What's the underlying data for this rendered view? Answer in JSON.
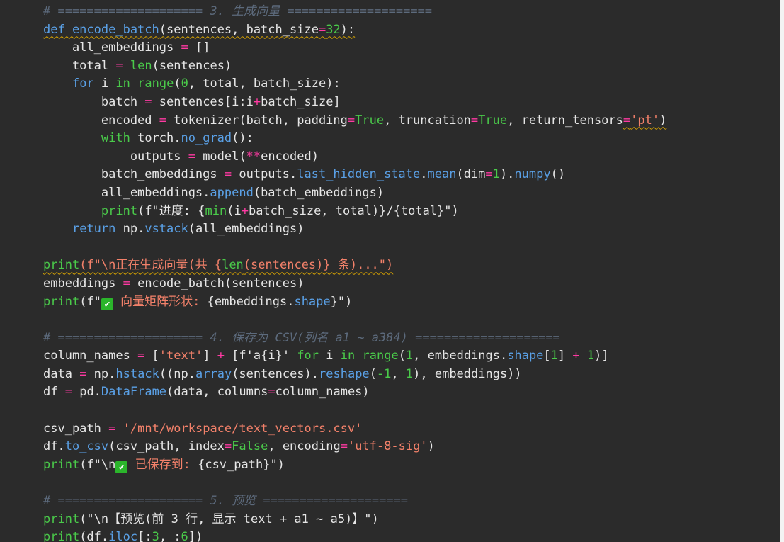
{
  "editor": {
    "colors": {
      "background": "#2b2b2b",
      "comment": "#5c6a7c",
      "keyword": "#4aca4a",
      "function": "#5aa0e6",
      "string": "#f3816a",
      "operator": "#ff3aa3",
      "text": "#e6e6e6",
      "warning_underline": "#d9a400"
    },
    "lines": [
      [
        {
          "t": "# ==================== 3. 生成向量 ====================",
          "c": "c"
        }
      ],
      [
        {
          "t": "def encode_batch",
          "c": "f",
          "u": true
        },
        {
          "t": "(sentences, batch_size",
          "c": "d",
          "u": true
        },
        {
          "t": "=",
          "c": "o",
          "u": true
        },
        {
          "t": "32",
          "c": "n",
          "u": true
        },
        {
          "t": "):",
          "c": "d",
          "u": true
        }
      ],
      [
        {
          "t": "    all_embeddings ",
          "c": "d"
        },
        {
          "t": "=",
          "c": "o"
        },
        {
          "t": " []",
          "c": "d"
        }
      ],
      [
        {
          "t": "    total ",
          "c": "d"
        },
        {
          "t": "=",
          "c": "o"
        },
        {
          "t": " ",
          "c": "d"
        },
        {
          "t": "len",
          "c": "k"
        },
        {
          "t": "(sentences)",
          "c": "d"
        }
      ],
      [
        {
          "t": "    ",
          "c": "d"
        },
        {
          "t": "for",
          "c": "f"
        },
        {
          "t": " i ",
          "c": "d"
        },
        {
          "t": "in",
          "c": "k"
        },
        {
          "t": " ",
          "c": "d"
        },
        {
          "t": "range",
          "c": "k"
        },
        {
          "t": "(",
          "c": "d"
        },
        {
          "t": "0",
          "c": "n"
        },
        {
          "t": ", total, batch_size):",
          "c": "d"
        }
      ],
      [
        {
          "t": "        batch ",
          "c": "d"
        },
        {
          "t": "=",
          "c": "o"
        },
        {
          "t": " sentences[i:i",
          "c": "d"
        },
        {
          "t": "+",
          "c": "o"
        },
        {
          "t": "batch_size]",
          "c": "d"
        }
      ],
      [
        {
          "t": "        encoded ",
          "c": "d"
        },
        {
          "t": "=",
          "c": "o"
        },
        {
          "t": " tokenizer(batch, padding",
          "c": "d"
        },
        {
          "t": "=",
          "c": "o"
        },
        {
          "t": "True",
          "c": "k"
        },
        {
          "t": ", truncation",
          "c": "d"
        },
        {
          "t": "=",
          "c": "o"
        },
        {
          "t": "True",
          "c": "k"
        },
        {
          "t": ", return_tensors",
          "c": "d"
        },
        {
          "t": "=",
          "c": "o",
          "u": true
        },
        {
          "t": "'pt'",
          "c": "s",
          "u": true
        },
        {
          "t": ")",
          "c": "d",
          "u": true
        }
      ],
      [
        {
          "t": "        ",
          "c": "d"
        },
        {
          "t": "with",
          "c": "k"
        },
        {
          "t": " torch.",
          "c": "d"
        },
        {
          "t": "no_grad",
          "c": "f"
        },
        {
          "t": "():",
          "c": "d"
        }
      ],
      [
        {
          "t": "            outputs ",
          "c": "d"
        },
        {
          "t": "=",
          "c": "o"
        },
        {
          "t": " model(",
          "c": "d"
        },
        {
          "t": "**",
          "c": "o"
        },
        {
          "t": "encoded)",
          "c": "d"
        }
      ],
      [
        {
          "t": "        batch_embeddings ",
          "c": "d"
        },
        {
          "t": "=",
          "c": "o"
        },
        {
          "t": " outputs.",
          "c": "d"
        },
        {
          "t": "last_hidden_state",
          "c": "f"
        },
        {
          "t": ".",
          "c": "d"
        },
        {
          "t": "mean",
          "c": "f"
        },
        {
          "t": "(dim",
          "c": "d"
        },
        {
          "t": "=",
          "c": "o"
        },
        {
          "t": "1",
          "c": "n"
        },
        {
          "t": ").",
          "c": "d"
        },
        {
          "t": "numpy",
          "c": "f"
        },
        {
          "t": "()",
          "c": "d"
        }
      ],
      [
        {
          "t": "        all_embeddings.",
          "c": "d"
        },
        {
          "t": "append",
          "c": "f"
        },
        {
          "t": "(batch_embeddings)",
          "c": "d"
        }
      ],
      [
        {
          "t": "        ",
          "c": "d"
        },
        {
          "t": "print",
          "c": "k"
        },
        {
          "t": "(f\"进度: {",
          "c": "d"
        },
        {
          "t": "min",
          "c": "k"
        },
        {
          "t": "(i",
          "c": "d"
        },
        {
          "t": "+",
          "c": "o"
        },
        {
          "t": "batch_size, total)}/{total}\")",
          "c": "d"
        }
      ],
      [
        {
          "t": "    ",
          "c": "d"
        },
        {
          "t": "return",
          "c": "f"
        },
        {
          "t": " np.",
          "c": "d"
        },
        {
          "t": "vstack",
          "c": "f"
        },
        {
          "t": "(all_embeddings)",
          "c": "d"
        }
      ],
      [],
      [
        {
          "t": "print",
          "c": "k",
          "u": true
        },
        {
          "t": "(f\"\\n正在生成向量(共 {",
          "c": "s",
          "u": true
        },
        {
          "t": "len",
          "c": "k",
          "u": true
        },
        {
          "t": "(sentences)} 条)...\")",
          "c": "s",
          "u": true
        }
      ],
      [
        {
          "t": "embeddings ",
          "c": "d"
        },
        {
          "t": "=",
          "c": "o"
        },
        {
          "t": " encode_batch(sentences)",
          "c": "d"
        }
      ],
      [
        {
          "t": "print",
          "c": "k"
        },
        {
          "t": "(f\"",
          "c": "d"
        },
        {
          "t": "✔",
          "c": "check"
        },
        {
          "t": " 向量矩阵形状: ",
          "c": "s"
        },
        {
          "t": "{embeddings.",
          "c": "d"
        },
        {
          "t": "shape",
          "c": "f"
        },
        {
          "t": "}\")",
          "c": "d"
        }
      ],
      [],
      [
        {
          "t": "# ==================== 4. 保存为 CSV(列名 a1 ~ a384) ====================",
          "c": "c"
        }
      ],
      [
        {
          "t": "column_names ",
          "c": "d"
        },
        {
          "t": "=",
          "c": "o"
        },
        {
          "t": " [",
          "c": "d"
        },
        {
          "t": "'text'",
          "c": "s"
        },
        {
          "t": "] ",
          "c": "d"
        },
        {
          "t": "+",
          "c": "o"
        },
        {
          "t": " [f'a{i}' ",
          "c": "d"
        },
        {
          "t": "for",
          "c": "k"
        },
        {
          "t": " i ",
          "c": "d"
        },
        {
          "t": "in",
          "c": "k"
        },
        {
          "t": " ",
          "c": "d"
        },
        {
          "t": "range",
          "c": "k"
        },
        {
          "t": "(",
          "c": "d"
        },
        {
          "t": "1",
          "c": "n"
        },
        {
          "t": ", embeddings.",
          "c": "d"
        },
        {
          "t": "shape",
          "c": "f"
        },
        {
          "t": "[",
          "c": "d"
        },
        {
          "t": "1",
          "c": "n"
        },
        {
          "t": "] ",
          "c": "d"
        },
        {
          "t": "+",
          "c": "o"
        },
        {
          "t": " ",
          "c": "d"
        },
        {
          "t": "1",
          "c": "n"
        },
        {
          "t": ")]",
          "c": "d"
        }
      ],
      [
        {
          "t": "data ",
          "c": "d"
        },
        {
          "t": "=",
          "c": "o"
        },
        {
          "t": " np.",
          "c": "d"
        },
        {
          "t": "hstack",
          "c": "f"
        },
        {
          "t": "((np.",
          "c": "d"
        },
        {
          "t": "array",
          "c": "f"
        },
        {
          "t": "(sentences).",
          "c": "d"
        },
        {
          "t": "reshape",
          "c": "f"
        },
        {
          "t": "(",
          "c": "d"
        },
        {
          "t": "-1",
          "c": "n"
        },
        {
          "t": ", ",
          "c": "d"
        },
        {
          "t": "1",
          "c": "n"
        },
        {
          "t": "), embeddings))",
          "c": "d"
        }
      ],
      [
        {
          "t": "df ",
          "c": "d"
        },
        {
          "t": "=",
          "c": "o"
        },
        {
          "t": " pd.",
          "c": "d"
        },
        {
          "t": "DataFrame",
          "c": "f"
        },
        {
          "t": "(data, columns",
          "c": "d"
        },
        {
          "t": "=",
          "c": "o"
        },
        {
          "t": "column_names)",
          "c": "d"
        }
      ],
      [],
      [
        {
          "t": "csv_path ",
          "c": "d"
        },
        {
          "t": "=",
          "c": "o"
        },
        {
          "t": " ",
          "c": "d"
        },
        {
          "t": "'/mnt/workspace/text_vectors.csv'",
          "c": "s"
        }
      ],
      [
        {
          "t": "df.",
          "c": "d"
        },
        {
          "t": "to_csv",
          "c": "f"
        },
        {
          "t": "(csv_path, index",
          "c": "d"
        },
        {
          "t": "=",
          "c": "o"
        },
        {
          "t": "False",
          "c": "k"
        },
        {
          "t": ", encoding",
          "c": "d"
        },
        {
          "t": "=",
          "c": "o"
        },
        {
          "t": "'utf-8-sig'",
          "c": "s"
        },
        {
          "t": ")",
          "c": "d"
        }
      ],
      [
        {
          "t": "print",
          "c": "k"
        },
        {
          "t": "(f\"\\n",
          "c": "d"
        },
        {
          "t": "✔",
          "c": "check"
        },
        {
          "t": " 已保存到: ",
          "c": "s"
        },
        {
          "t": "{csv_path}\")",
          "c": "d"
        }
      ],
      [],
      [
        {
          "t": "# ==================== 5. 预览 ====================",
          "c": "c"
        }
      ],
      [
        {
          "t": "print",
          "c": "k"
        },
        {
          "t": "(\"\\n【预览(前 3 行, 显示 text + a1 ~ a5)】\")",
          "c": "d"
        }
      ],
      [
        {
          "t": "print",
          "c": "k"
        },
        {
          "t": "(df.",
          "c": "d"
        },
        {
          "t": "iloc",
          "c": "f"
        },
        {
          "t": "[:",
          "c": "d"
        },
        {
          "t": "3",
          "c": "n"
        },
        {
          "t": ", :",
          "c": "d"
        },
        {
          "t": "6",
          "c": "n"
        },
        {
          "t": "])",
          "c": "d"
        }
      ]
    ]
  }
}
